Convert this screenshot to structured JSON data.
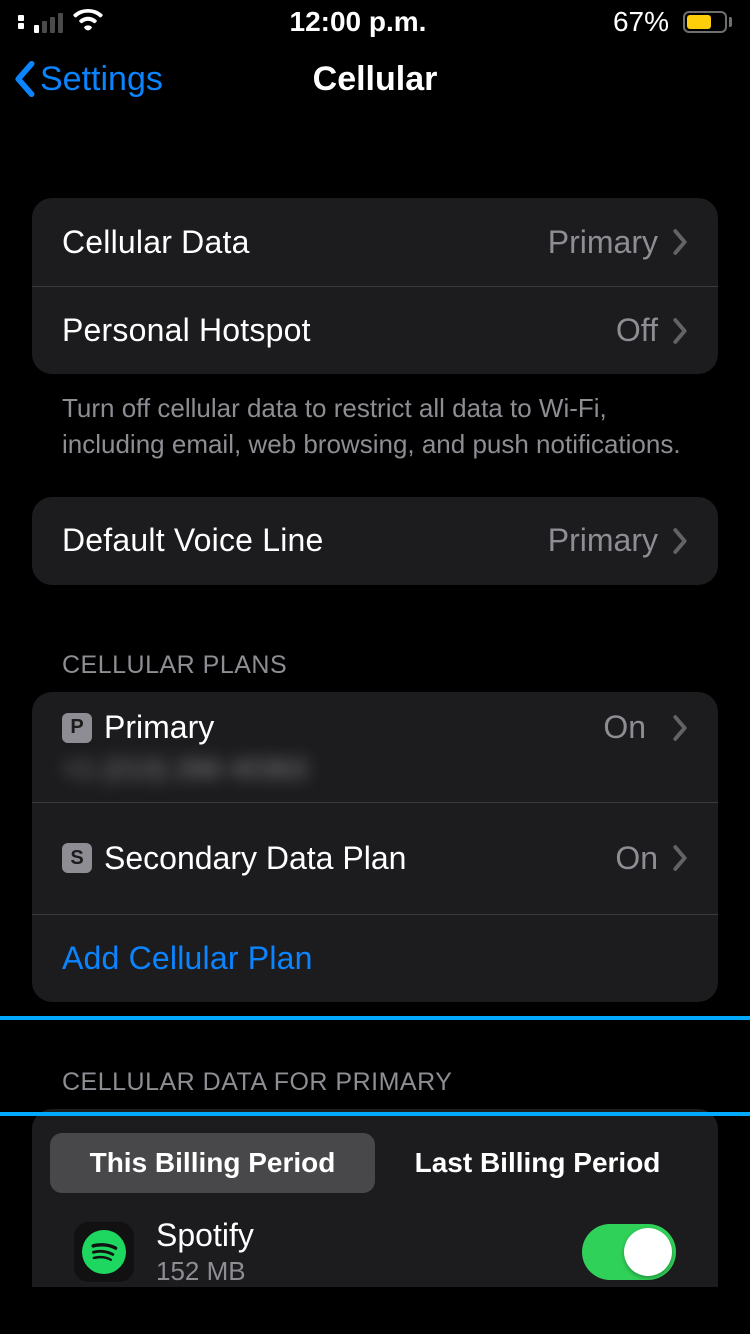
{
  "status_bar": {
    "time": "12:00 p.m.",
    "battery_pct": "67%",
    "battery_fill_pct": 67
  },
  "nav": {
    "back_label": "Settings",
    "title": "Cellular"
  },
  "group1": {
    "cellular_data_label": "Cellular Data",
    "cellular_data_value": "Primary",
    "hotspot_label": "Personal Hotspot",
    "hotspot_value": "Off",
    "footer": "Turn off cellular data to restrict all data to Wi-Fi, including email, web browsing, and push notifications."
  },
  "group2": {
    "voice_label": "Default Voice Line",
    "voice_value": "Primary"
  },
  "plans": {
    "header": "CELLULAR PLANS",
    "primary_badge": "P",
    "primary_name": "Primary",
    "primary_sub": "+1 (213) 266 40363",
    "primary_value": "On",
    "secondary_badge": "S",
    "secondary_name": "Secondary Data Plan",
    "secondary_value": "On",
    "add_label": "Add Cellular Plan"
  },
  "usage": {
    "header": "CELLULAR DATA FOR PRIMARY",
    "seg_this": "This Billing Period",
    "seg_last": "Last Billing Period",
    "app_name": "Spotify",
    "app_size": "152 MB"
  }
}
